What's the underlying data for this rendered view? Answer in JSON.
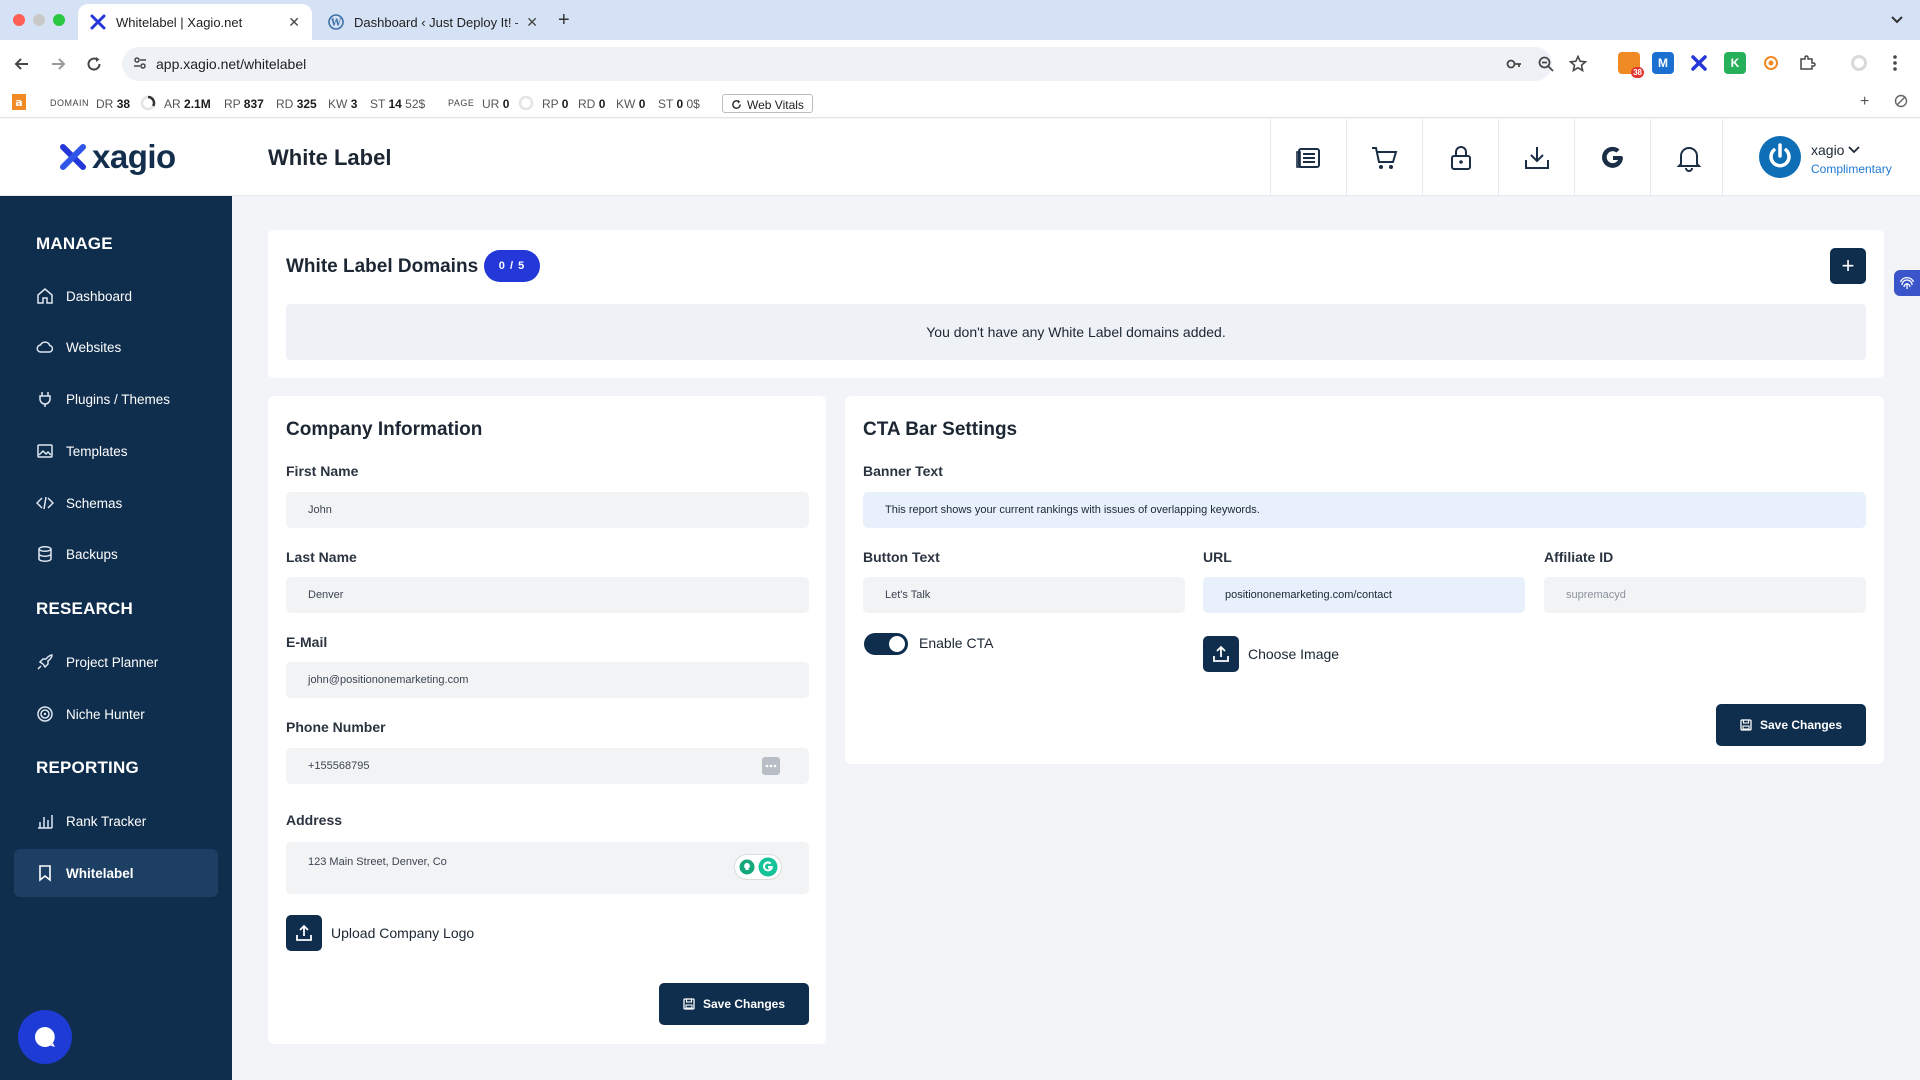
{
  "browser": {
    "tabs": [
      {
        "title": "Whitelabel | Xagio.net",
        "active": true
      },
      {
        "title": "Dashboard ‹ Just Deploy It! —",
        "active": false
      }
    ],
    "new_tab": "+",
    "url": "app.xagio.net/whitelabel",
    "extension_badge": "38"
  },
  "seobar": {
    "domain_label": "DOMAIN",
    "dr": "DR",
    "dr_val": "38",
    "ar": "AR",
    "ar_val": "2.1M",
    "rp": "RP",
    "rp_val": "837",
    "rd": "RD",
    "rd_val": "325",
    "kw": "KW",
    "kw_val": "3",
    "st": "ST",
    "st_val": "14",
    "st_money": "52$",
    "page_label": "PAGE",
    "ur": "UR",
    "ur_val": "0",
    "prp": "RP",
    "prp_val": "0",
    "prd": "RD",
    "prd_val": "0",
    "pkw": "KW",
    "pkw_val": "0",
    "pst": "ST",
    "pst_val": "0",
    "pst_money": "0$",
    "web_vitals": "Web Vitals"
  },
  "header": {
    "logo_text": "xagio",
    "page_title": "White Label",
    "user_name": "xagio",
    "user_plan": "Complimentary"
  },
  "sidebar": {
    "sections": [
      {
        "title": "MANAGE",
        "items": [
          "Dashboard",
          "Websites",
          "Plugins / Themes",
          "Templates",
          "Schemas",
          "Backups"
        ]
      },
      {
        "title": "RESEARCH",
        "items": [
          "Project Planner",
          "Niche Hunter"
        ]
      },
      {
        "title": "REPORTING",
        "items": [
          "Rank Tracker",
          "Whitelabel"
        ]
      }
    ],
    "active": "Whitelabel"
  },
  "domains": {
    "title": "White Label Domains",
    "badge": "0 / 5",
    "add": "+",
    "empty_message": "You don't have any White Label domains added."
  },
  "company": {
    "title": "Company Information",
    "first_name_label": "First Name",
    "first_name": "John",
    "last_name_label": "Last Name",
    "last_name": "Denver",
    "email_label": "E-Mail",
    "email": "john@positiononemarketing.com",
    "phone_label": "Phone Number",
    "phone": "+155568795",
    "address_label": "Address",
    "address": "123 Main Street, Denver, Co",
    "upload_logo": "Upload Company Logo",
    "save": "Save Changes"
  },
  "cta": {
    "title": "CTA Bar Settings",
    "banner_label": "Banner Text",
    "banner_text": "This report shows your current rankings with issues of overlapping keywords.",
    "button_text_label": "Button Text",
    "button_text": "Let's Talk",
    "url_label": "URL",
    "url": "positiononemarketing.com/contact",
    "affiliate_label": "Affiliate ID",
    "affiliate_placeholder": "supremacyd",
    "enable_cta_label": "Enable CTA",
    "enable_cta": true,
    "choose_image": "Choose Image",
    "save": "Save Changes"
  },
  "colors": {
    "sidebar": "#0f2d4c",
    "accent_badge": "#2437d8",
    "chat": "#1f3bd6"
  }
}
